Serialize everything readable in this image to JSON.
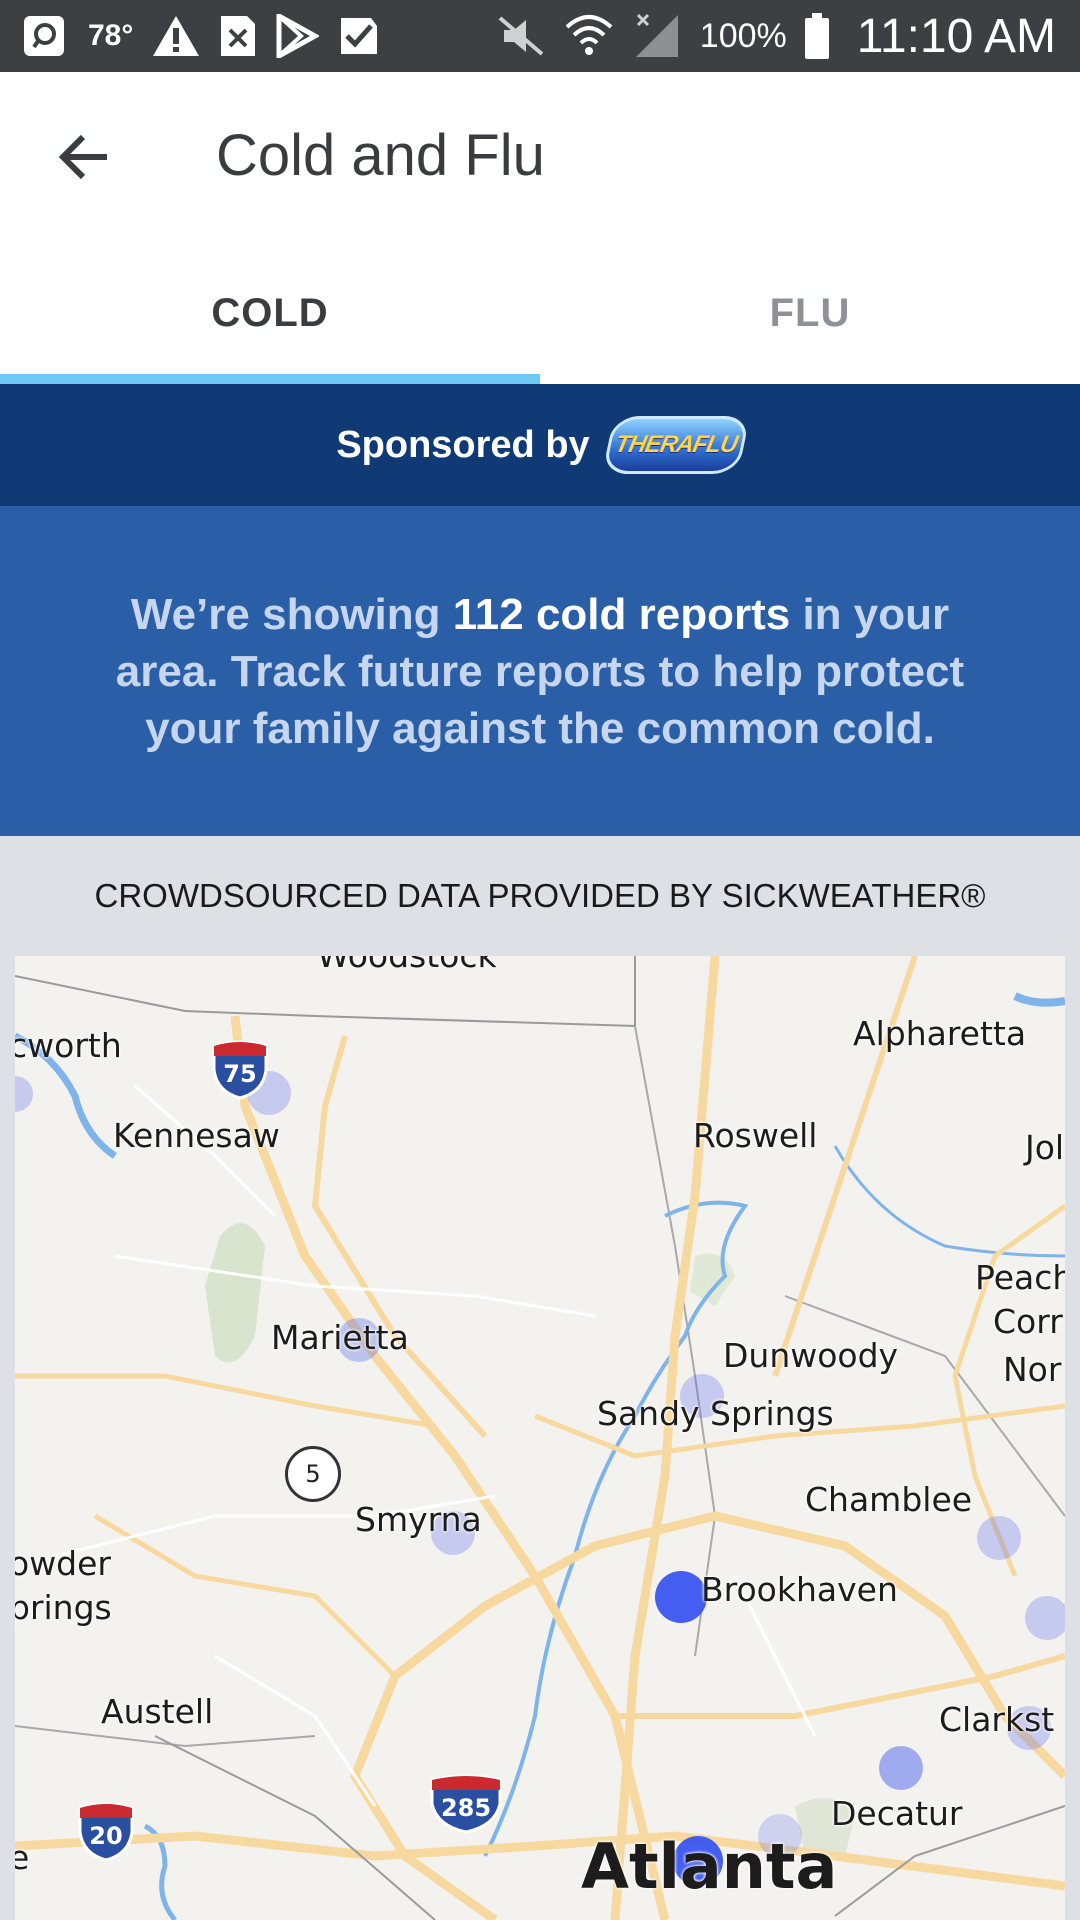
{
  "status_bar": {
    "temperature": "78°",
    "battery": "100%",
    "time": "11:10 AM",
    "icons": [
      "message-icon",
      "warning-icon",
      "close-box-icon",
      "play-store-icon",
      "check-icon",
      "mute-icon",
      "wifi-icon",
      "signal-icon",
      "battery-icon"
    ]
  },
  "header": {
    "title": "Cold and Flu",
    "back_icon": "arrow-left-icon"
  },
  "tabs": [
    {
      "label": "COLD",
      "active": true
    },
    {
      "label": "FLU",
      "active": false
    }
  ],
  "sponsor": {
    "text": "Sponsored by",
    "brand": "THERAFLU"
  },
  "info": {
    "prefix": "We’re showing ",
    "highlight": "112 cold reports",
    "suffix": " in your area. Track future reports to help protect your family against the common cold."
  },
  "credit": "CROWDSOURCED DATA PROVIDED BY SICKWEATHER®",
  "map": {
    "places": [
      "Woodstock",
      "cworth",
      "Alpharetta",
      "Kennesaw",
      "Roswell",
      "Jol",
      "Peach",
      "Corr",
      "Marietta",
      "Dunwoody",
      "Nor",
      "Sandy Springs",
      "Chamblee",
      "Smyrna",
      "owder",
      "prings",
      "Brookhaven",
      "Austell",
      "Clarkst",
      "Decatur",
      "e",
      "Atlanta"
    ],
    "shields": [
      "75",
      "285",
      "20"
    ],
    "state_route": "5",
    "colors": {
      "report_dot": "#3a55f0",
      "highway": "#f7d9a0",
      "water": "#7fb4ea"
    }
  }
}
